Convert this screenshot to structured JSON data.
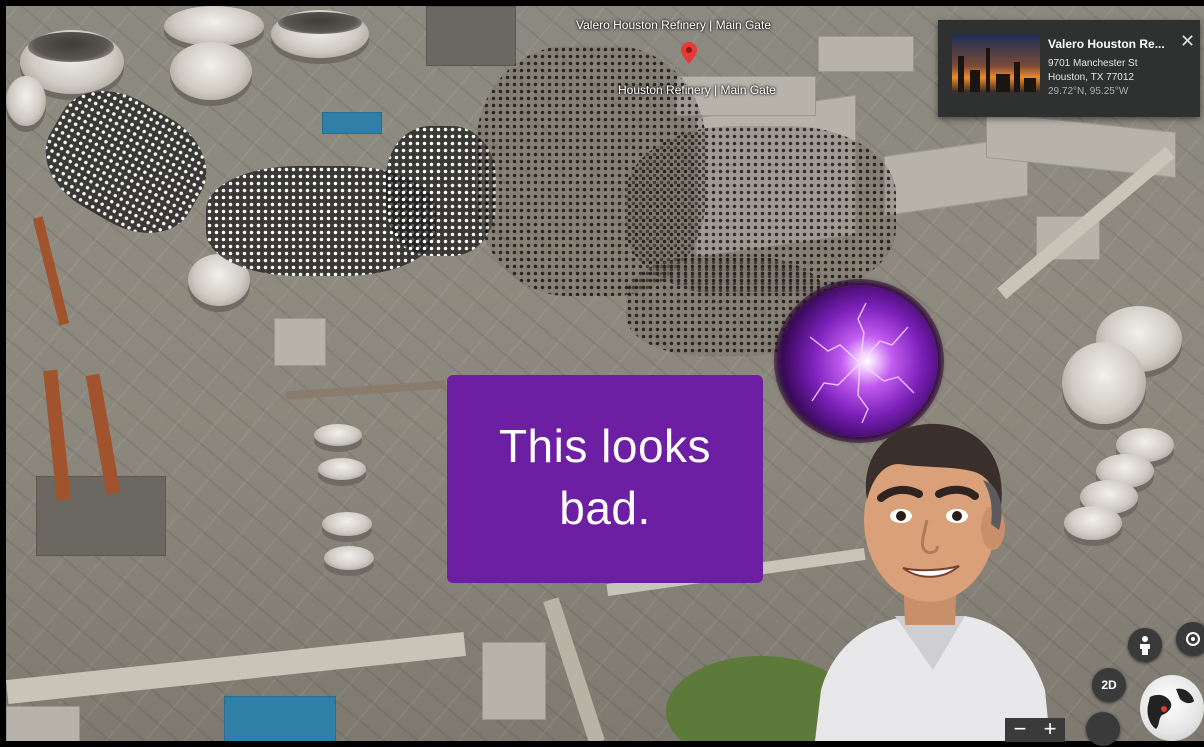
{
  "map": {
    "place_label_top": "Valero Houston Refinery | Main Gate",
    "place_label_pin": "Houston Refinery | Main Gate"
  },
  "info_card": {
    "title": "Valero Houston Re...",
    "address_line1": "9701 Manchester St",
    "address_line2": "Houston, TX 77012",
    "coordinates": "29.72°N, 95.25°W",
    "close_icon": "✕"
  },
  "speech_bubble": {
    "line1": "This looks",
    "line2": "bad."
  },
  "controls": {
    "mode_2d_label": "2D",
    "zoom_out_label": "−",
    "zoom_in_label": "+"
  },
  "icons": [
    "map-pin-icon",
    "close-icon",
    "pegman-icon",
    "target-icon",
    "compass-icon",
    "globe-icon"
  ],
  "colors": {
    "bubble": "#6d1fa3",
    "card_bg": "#2f3030",
    "pin": "#e53935",
    "orb": "#7a1fb8"
  }
}
